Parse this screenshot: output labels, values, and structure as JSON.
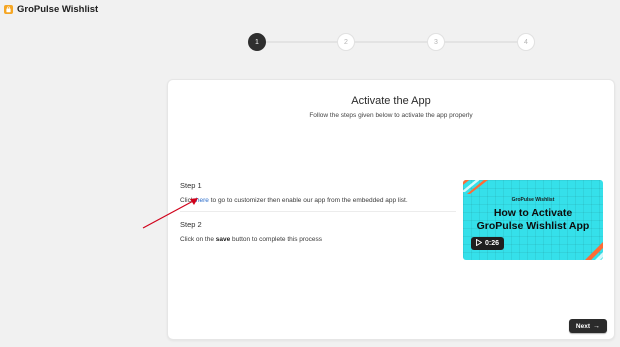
{
  "header": {
    "title": "GroPulse Wishlist",
    "logo_icon": "shopping-bag-icon",
    "logo_color": "#f5a623"
  },
  "stepper": {
    "active_step": 1,
    "steps": [
      {
        "label": "1",
        "state": "active"
      },
      {
        "label": "2",
        "state": "inactive"
      },
      {
        "label": "3",
        "state": "inactive"
      },
      {
        "label": "4",
        "state": "inactive"
      }
    ]
  },
  "card": {
    "title": "Activate the App",
    "subtitle": "Follow the steps given below to activate the app properly",
    "step1": {
      "heading": "Step 1",
      "text_before": "Click ",
      "link": "here",
      "text_after": " to go to customizer then enable our app from the embedded app list."
    },
    "step2": {
      "heading": "Step 2",
      "text_before": "Click on the ",
      "bold": "save",
      "text_after": " button to complete this process"
    },
    "video": {
      "brand": "GroPulse Wishlist",
      "headline_line1": "How to Activate",
      "headline_line2": "GroPulse Wishlist App",
      "duration": "0:26",
      "background_color": "#35e0ea",
      "accent_color": "#ff6b35"
    },
    "next_button": {
      "label": "Next",
      "icon": "arrow-right-icon"
    }
  },
  "annotation": {
    "arrow_color": "#d0021b",
    "target": "here-link"
  }
}
